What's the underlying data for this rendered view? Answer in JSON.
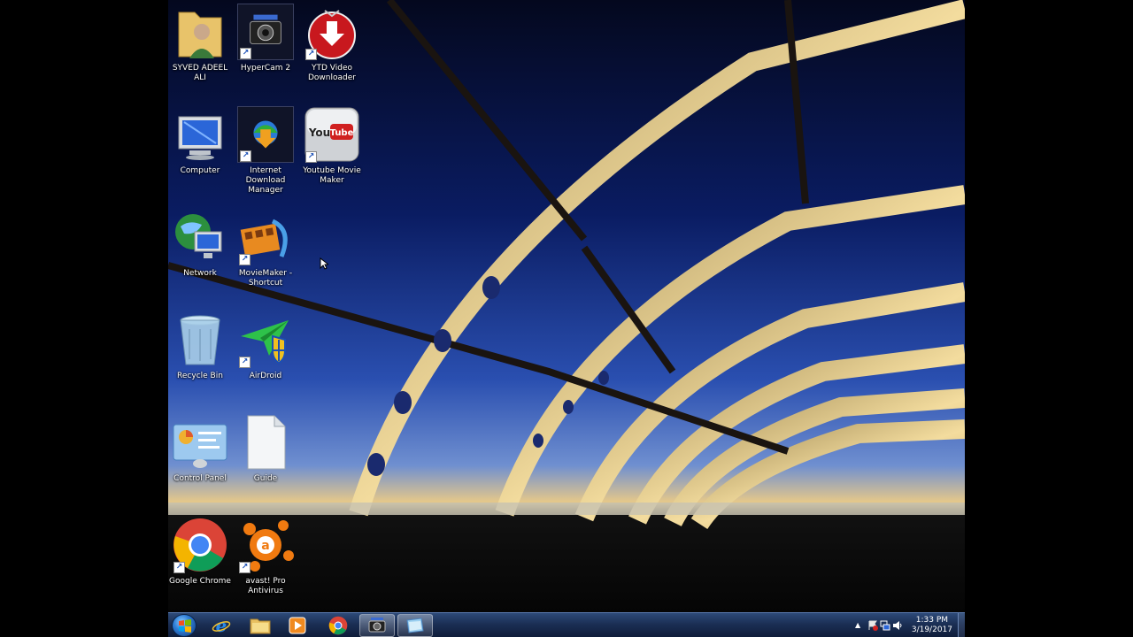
{
  "desktop": {
    "icons": [
      {
        "label": "SYVED ADEEL ALI",
        "icon": "user-folder-icon",
        "shortcut": false
      },
      {
        "label": "HyperCam 2",
        "icon": "hypercam-icon",
        "shortcut": true
      },
      {
        "label": "YTD Video Downloader",
        "icon": "ytd-downloader-icon",
        "shortcut": true
      },
      {
        "label": "Computer",
        "icon": "computer-icon",
        "shortcut": false
      },
      {
        "label": "Internet Download Manager",
        "icon": "idm-icon",
        "shortcut": true
      },
      {
        "label": "Youtube Movie Maker",
        "icon": "youtube-icon",
        "shortcut": true
      },
      {
        "label": "Network",
        "icon": "network-icon",
        "shortcut": false
      },
      {
        "label": "MovieMaker - Shortcut",
        "icon": "moviemaker-icon",
        "shortcut": true
      },
      {
        "label": "Recycle Bin",
        "icon": "recycle-bin-icon",
        "shortcut": false
      },
      {
        "label": "AirDroid",
        "icon": "airdroid-icon",
        "shortcut": true
      },
      {
        "label": "Control Panel",
        "icon": "control-panel-icon",
        "shortcut": false
      },
      {
        "label": "Guide",
        "icon": "document-icon",
        "shortcut": false
      },
      {
        "label": "Google Chrome",
        "icon": "chrome-icon",
        "shortcut": true
      },
      {
        "label": "avast! Pro Antivirus",
        "icon": "avast-icon",
        "shortcut": true
      }
    ]
  },
  "taskbar": {
    "pinned": [
      {
        "icon": "internet-explorer-icon"
      },
      {
        "icon": "file-explorer-icon"
      },
      {
        "icon": "media-player-icon"
      },
      {
        "icon": "chrome-icon"
      },
      {
        "icon": "hypercam-icon",
        "active": true
      },
      {
        "icon": "window-app-icon"
      }
    ],
    "clock": {
      "time": "1:33 PM",
      "date": "3/19/2017"
    }
  },
  "colors": {
    "taskbar": "#1b2f55",
    "accent": "#2f7ed8"
  }
}
